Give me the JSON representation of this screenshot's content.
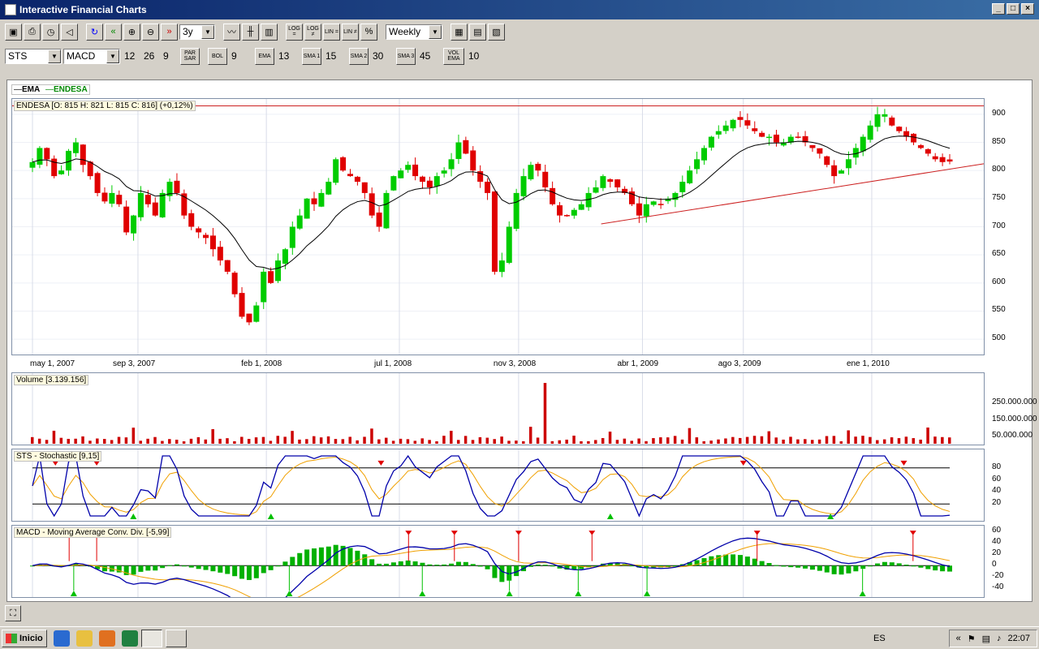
{
  "window": {
    "title": "Interactive Financial Charts"
  },
  "toolbar1": {
    "period_value": "3y",
    "freq_value": "Weekly",
    "buttons": [
      "open",
      "print",
      "clock",
      "sound",
      "refresh",
      "back",
      "zoom-in",
      "zoom-out",
      "forward"
    ],
    "scale_buttons": [
      "LOG =",
      "LOG ≠",
      "LIN =",
      "LIN ≠",
      "%"
    ]
  },
  "toolbar2": {
    "indicator1": "STS",
    "indicator2": "MACD",
    "macd_params": [
      "12",
      "26",
      "9"
    ],
    "parsar_label": "PAR SAR",
    "bol_label": "BOL",
    "bol_value": "9",
    "ema_label": "EMA",
    "ema_value": "13",
    "sma1_label": "SMA 1",
    "sma1_value": "15",
    "sma2_label": "SMA 2",
    "sma2_value": "30",
    "sma3_label": "SMA 3",
    "sma3_value": "45",
    "volema_label": "VOL EMA",
    "volema_value": "10"
  },
  "legend": {
    "ema": "EMA",
    "endesa": "ENDESA"
  },
  "price_panel": {
    "label": "ENDESA [O: 815  H: 821  L: 815  C: 816] (+0,12%)",
    "y_ticks": [
      "900",
      "850",
      "800",
      "750",
      "700",
      "650",
      "600",
      "550",
      "500"
    ],
    "x_ticks": [
      "may 1, 2007",
      "sep 3, 2007",
      "feb 1, 2008",
      "jul 1, 2008",
      "nov 3, 2008",
      "abr 1, 2009",
      "ago 3, 2009",
      "ene 1, 2010"
    ]
  },
  "volume_panel": {
    "label": "Volume [3.139.156]",
    "y_ticks": [
      "250.000.000",
      "150.000.000",
      "50.000.000"
    ]
  },
  "stoch_panel": {
    "label": "STS - Stochastic [9,15]",
    "y_ticks": [
      "80",
      "60",
      "40",
      "20"
    ]
  },
  "macd_panel": {
    "label": "MACD - Moving Average Conv. Div. [-5,99]",
    "y_ticks": [
      "60",
      "40",
      "20",
      "0",
      "-20",
      "-40"
    ]
  },
  "colors": {
    "up": "#00cc00",
    "down": "#e00000",
    "ema_line": "#000000",
    "stoch_k": "#0000aa",
    "stoch_d": "#f0a000",
    "volume": "#cc0000",
    "trend": "#cc2020"
  },
  "chart_data": {
    "type": "candlestick",
    "frequency": "Weekly",
    "instrument": "ENDESA",
    "ylim": [
      480,
      920
    ],
    "price_path": [
      815,
      840,
      820,
      790,
      800,
      835,
      850,
      810,
      790,
      760,
      745,
      760,
      740,
      690,
      720,
      760,
      740,
      720,
      760,
      780,
      760,
      720,
      700,
      690,
      680,
      660,
      640,
      620,
      580,
      540,
      530,
      560,
      620,
      600,
      640,
      660,
      700,
      720,
      750,
      740,
      760,
      780,
      820,
      800,
      790,
      780,
      760,
      720,
      700,
      760,
      790,
      800,
      810,
      790,
      780,
      770,
      790,
      800,
      820,
      850,
      830,
      800,
      780,
      760,
      620,
      640,
      700,
      760,
      790,
      810,
      800,
      770,
      740,
      720,
      720,
      730,
      740,
      760,
      770,
      790,
      780,
      770,
      760,
      740,
      720,
      740,
      745,
      740,
      750,
      760,
      780,
      800,
      820,
      840,
      860,
      870,
      880,
      890,
      890,
      880,
      870,
      860,
      860,
      850,
      850,
      860,
      860,
      850,
      840,
      830,
      810,
      790,
      800,
      820,
      840,
      860,
      880,
      900,
      900,
      880,
      870,
      860,
      850,
      840,
      830,
      820,
      815,
      816
    ],
    "volume_spike_week": "nov 3, 2008"
  },
  "taskbar": {
    "start": "Inicio",
    "lang": "ES",
    "time": "22:07"
  }
}
